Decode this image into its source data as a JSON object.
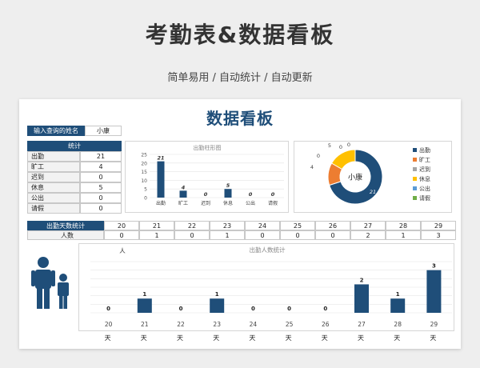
{
  "header": {
    "title": "考勤表&数据看板",
    "subtitle": "简单易用  /  自动统计  /  自动更新"
  },
  "board": {
    "title": "数据看板"
  },
  "query": {
    "label": "输入查询的姓名",
    "value": "小康"
  },
  "stats": {
    "header": "统计",
    "rows": [
      {
        "label": "出勤",
        "value": "21"
      },
      {
        "label": "旷工",
        "value": "4"
      },
      {
        "label": "迟到",
        "value": "0"
      },
      {
        "label": "休息",
        "value": "5"
      },
      {
        "label": "公出",
        "value": "0"
      },
      {
        "label": "请假",
        "value": "0"
      }
    ]
  },
  "days_table": {
    "row1_label": "出勤天数统计",
    "row2_label": "人数",
    "days": [
      "20",
      "21",
      "22",
      "23",
      "24",
      "25",
      "26",
      "27",
      "28",
      "29"
    ],
    "counts": [
      "0",
      "1",
      "0",
      "1",
      "0",
      "0",
      "0",
      "2",
      "1",
      "3"
    ]
  },
  "legend_colors": {
    "出勤": "#1f4e79",
    "旷工": "#ed7d31",
    "迟到": "#a5a5a5",
    "休息": "#ffc000",
    "公出": "#5b9bd5",
    "请假": "#70ad47"
  },
  "chart_data": [
    {
      "type": "bar",
      "title": "出勤柱形图",
      "categories": [
        "出勤",
        "旷工",
        "迟到",
        "休息",
        "公出",
        "请假"
      ],
      "values": [
        21,
        4,
        0,
        5,
        0,
        0
      ],
      "ylim": [
        0,
        25
      ],
      "yticks": [
        0,
        5,
        10,
        15,
        20,
        25
      ],
      "grid": true,
      "color": "#1f4e79"
    },
    {
      "type": "pie",
      "title": "",
      "center_label": "小康",
      "categories": [
        "出勤",
        "旷工",
        "迟到",
        "休息",
        "公出",
        "请假"
      ],
      "values": [
        21,
        4,
        0,
        5,
        0,
        0
      ],
      "outside_labels": [
        "5",
        "0",
        "0",
        "4",
        "0"
      ],
      "legend_position": "right"
    },
    {
      "type": "bar",
      "title": "出勤人数统计",
      "ylabel": "人",
      "categories": [
        "20",
        "21",
        "22",
        "23",
        "24",
        "25",
        "26",
        "27",
        "28",
        "29"
      ],
      "category_suffix": "天",
      "values": [
        0,
        1,
        0,
        1,
        0,
        0,
        0,
        2,
        1,
        3
      ],
      "ylim": [
        0,
        3.6
      ],
      "grid": true,
      "color": "#1f4e79"
    }
  ]
}
